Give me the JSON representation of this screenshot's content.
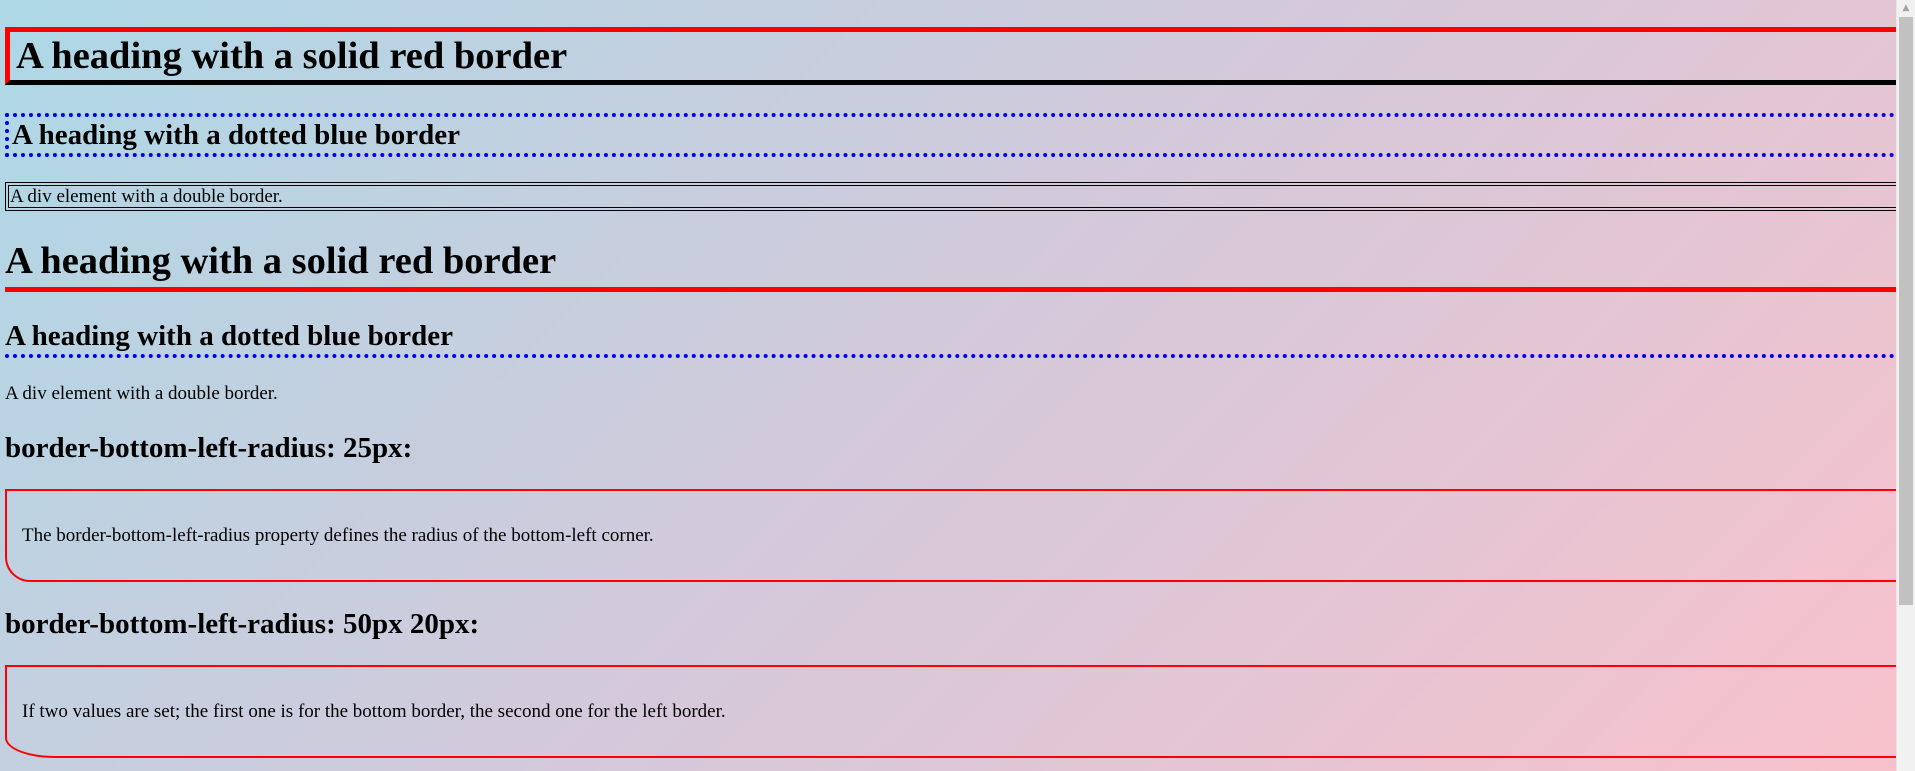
{
  "headings": {
    "solid_red_1": "A heading with a solid red border",
    "dotted_blue_1": "A heading with a dotted blue border",
    "solid_red_2": "A heading with a solid red border",
    "dotted_blue_2": "A heading with a dotted blue border",
    "radius_25": "border-bottom-left-radius: 25px:",
    "radius_50_20": "border-bottom-left-radius: 50px 20px:"
  },
  "divs": {
    "double_border_1": "A div element with a double border.",
    "double_border_2": "A div element with a double border."
  },
  "boxes": {
    "radius_25_text": "The border-bottom-left-radius property defines the radius of the bottom-left corner.",
    "radius_50_20_text": "If two values are set; the first one is for the bottom border, the second one for the left border."
  },
  "colors": {
    "red": "#ff0000",
    "blue": "#0000f0",
    "gradient_start": "#add8e6",
    "gradient_end": "#f8c1cb"
  },
  "scrollbar": {
    "up_arrow_icon": "▲"
  }
}
